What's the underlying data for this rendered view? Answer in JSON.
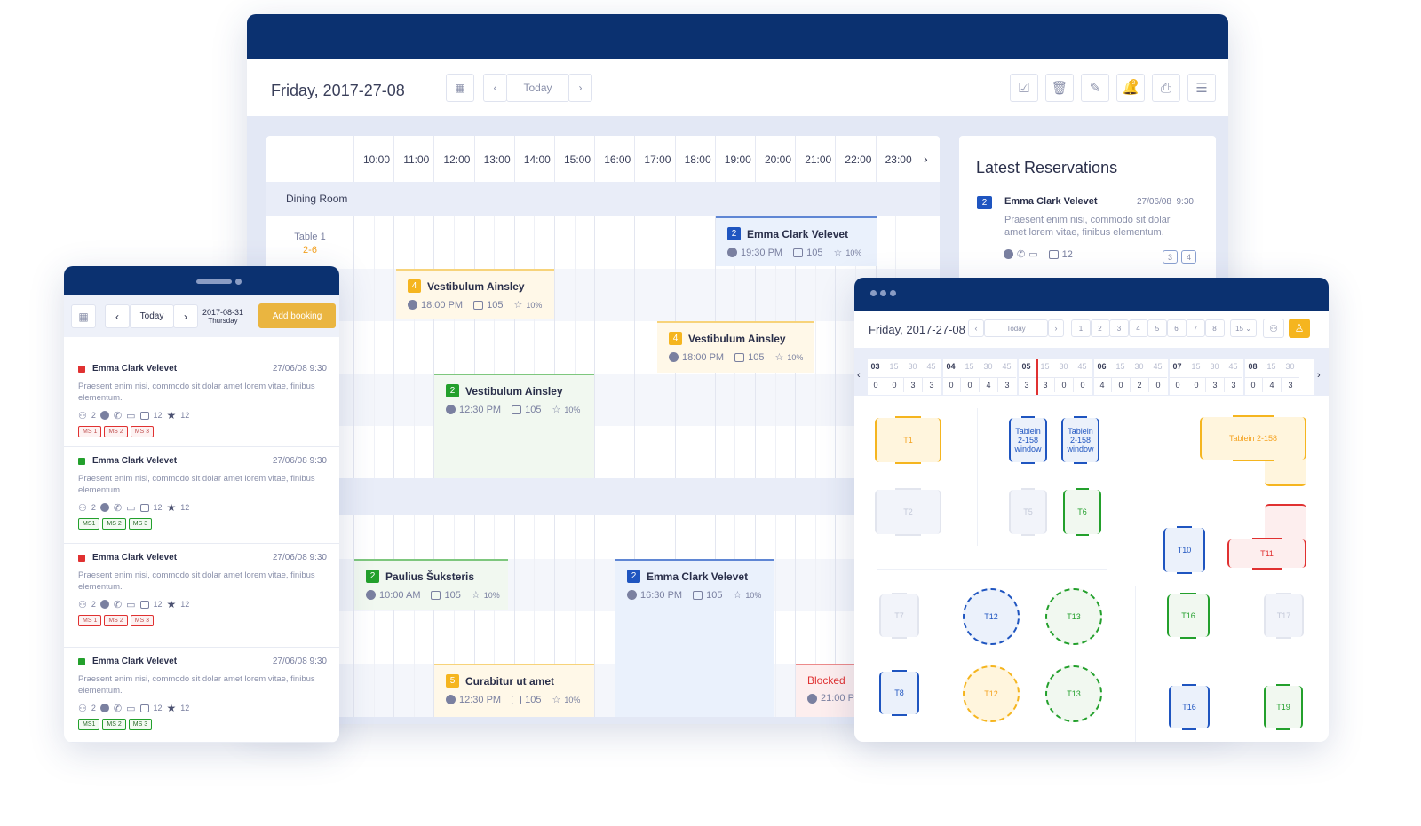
{
  "main": {
    "date": "Friday, 2017-27-08",
    "today": "Today",
    "prev": "‹",
    "next": "›",
    "toolbar_icons": [
      "check-square-icon",
      "trash-icon",
      "edit-icon",
      "bell-icon",
      "print-icon",
      "list-icon"
    ],
    "bell_count": "2",
    "hours": [
      "10:00",
      "11:00",
      "12:00",
      "13:00",
      "14:00",
      "15:00",
      "16:00",
      "17:00",
      "18:00",
      "19:00",
      "20:00",
      "21:00",
      "22:00",
      "23:00"
    ],
    "section": "Dining Room",
    "table_name": "Table 1",
    "table_range": "2-6",
    "bookings": [
      {
        "guests": "2",
        "name": "Emma Clark Velevet",
        "time": "19:30 PM",
        "number": "105",
        "discount": "10%",
        "status": "blue"
      },
      {
        "guests": "4",
        "name": "Vestibulum Ainsley",
        "time": "18:00 PM",
        "number": "105",
        "discount": "10%",
        "status": "yellow"
      },
      {
        "guests": "4",
        "name": "Vestibulum Ainsley",
        "time": "18:00 PM",
        "number": "105",
        "discount": "10%",
        "status": "yellow"
      },
      {
        "guests": "2",
        "name": "Vestibulum Ainsley",
        "time": "12:30 PM",
        "number": "105",
        "discount": "10%",
        "status": "green"
      },
      {
        "guests": "2",
        "name": "Paulius Šuksteris",
        "time": "10:00 AM",
        "number": "105",
        "discount": "10%",
        "status": "green"
      },
      {
        "guests": "2",
        "name": "Emma Clark Velevet",
        "time": "16:30 PM",
        "number": "105",
        "discount": "10%",
        "status": "blue"
      },
      {
        "guests": "5",
        "name": "Curabitur ut amet",
        "time": "12:30 PM",
        "number": "105",
        "discount": "10%",
        "status": "yellow"
      },
      {
        "guests": "",
        "name": "Blocked",
        "time": "21:00 PM",
        "number": "",
        "discount": "",
        "status": "red"
      }
    ],
    "latest": {
      "title": "Latest Reservations",
      "badge": "2",
      "name": "Emma Clark Velevet",
      "date": "27/06/08  9:30",
      "desc": "Praesent enim nisi, commodo sit dolar amet lorem vitae, finibus elementum.",
      "count": "12",
      "tables": [
        "3",
        "4"
      ]
    }
  },
  "mobile": {
    "today": "Today",
    "date": "2017-08-31",
    "weekday": "Thursday",
    "add_booking": "Add booking",
    "items": [
      {
        "name": "Emma Clark Velevet",
        "date": "27/06/08 9:30",
        "desc": "Praesent enim nisi, commodo sit dolar amet lorem vitae, finibus elementum.",
        "guests": "2",
        "count": "12",
        "stars": "12",
        "tags": [
          "MS 1",
          "MS 2",
          "MS 3"
        ],
        "status": "red"
      },
      {
        "name": "Emma Clark Velevet",
        "date": "27/06/08 9:30",
        "desc": "Praesent enim nisi, commodo sit dolar amet lorem vitae, finibus elementum.",
        "guests": "2",
        "count": "12",
        "stars": "12",
        "tags": [
          "MS1",
          "MS 2",
          "MS 3"
        ],
        "status": "green"
      },
      {
        "name": "Emma Clark Velevet",
        "date": "27/06/08 9:30",
        "desc": "Praesent enim nisi, commodo sit dolar amet lorem vitae, finibus elementum.",
        "guests": "2",
        "count": "12",
        "stars": "12",
        "tags": [
          "MS 1",
          "MS 2",
          "MS 3"
        ],
        "status": "red"
      },
      {
        "name": "Emma Clark Velevet",
        "date": "27/06/08 9:30",
        "desc": "Praesent enim nisi, commodo sit dolar amet lorem vitae, finibus elementum.",
        "guests": "2",
        "count": "12",
        "stars": "12",
        "tags": [
          "MS1",
          "MS 2",
          "MS 3"
        ],
        "status": "green"
      }
    ]
  },
  "floor": {
    "date": "Friday, 2017-27-08",
    "today": "Today",
    "pages": [
      "1",
      "2",
      "3",
      "4",
      "5",
      "6",
      "7",
      "8"
    ],
    "interval": "15",
    "timeline": [
      {
        "hour": "03",
        "subs": [
          "15",
          "30",
          "45"
        ],
        "counts": [
          "0",
          "0",
          "3",
          "3"
        ]
      },
      {
        "hour": "04",
        "subs": [
          "15",
          "30",
          "45"
        ],
        "counts": [
          "0",
          "0",
          "4",
          "3"
        ]
      },
      {
        "hour": "05",
        "subs": [
          "15",
          "30",
          "45"
        ],
        "counts": [
          "3",
          "3",
          "0",
          "0"
        ]
      },
      {
        "hour": "06",
        "subs": [
          "15",
          "30",
          "45"
        ],
        "counts": [
          "4",
          "0",
          "2",
          "0"
        ]
      },
      {
        "hour": "07",
        "subs": [
          "15",
          "30",
          "45"
        ],
        "counts": [
          "0",
          "0",
          "3",
          "3"
        ]
      },
      {
        "hour": "08",
        "subs": [
          "15",
          "30"
        ],
        "counts": [
          "0",
          "4",
          "3"
        ]
      }
    ],
    "tables": [
      {
        "label": "T1",
        "status": "yellow"
      },
      {
        "label": "Tablein 2-158 window",
        "status": "blue"
      },
      {
        "label": "Tablein 2-158 window",
        "status": "blue"
      },
      {
        "label": "Tablein 2-158",
        "status": "yellow"
      },
      {
        "label": "T2",
        "status": "gray"
      },
      {
        "label": "T5",
        "status": "gray"
      },
      {
        "label": "T6",
        "status": "green"
      },
      {
        "label": "T10",
        "status": "blue"
      },
      {
        "label": "T11",
        "status": "red"
      },
      {
        "label": "T7",
        "status": "gray"
      },
      {
        "label": "T12",
        "status": "blue"
      },
      {
        "label": "T13",
        "status": "green"
      },
      {
        "label": "T16",
        "status": "green"
      },
      {
        "label": "T17",
        "status": "gray"
      },
      {
        "label": "T8",
        "status": "blue"
      },
      {
        "label": "T12",
        "status": "yellow"
      },
      {
        "label": "T13",
        "status": "green"
      },
      {
        "label": "T16",
        "status": "blue"
      },
      {
        "label": "T19",
        "status": "green"
      }
    ]
  },
  "colors": {
    "navy": "#0b3170",
    "blue": "#1f55c0",
    "green": "#23a02c",
    "yellow": "#f5b51f",
    "red": "#e03131",
    "accent": "#eab540"
  }
}
